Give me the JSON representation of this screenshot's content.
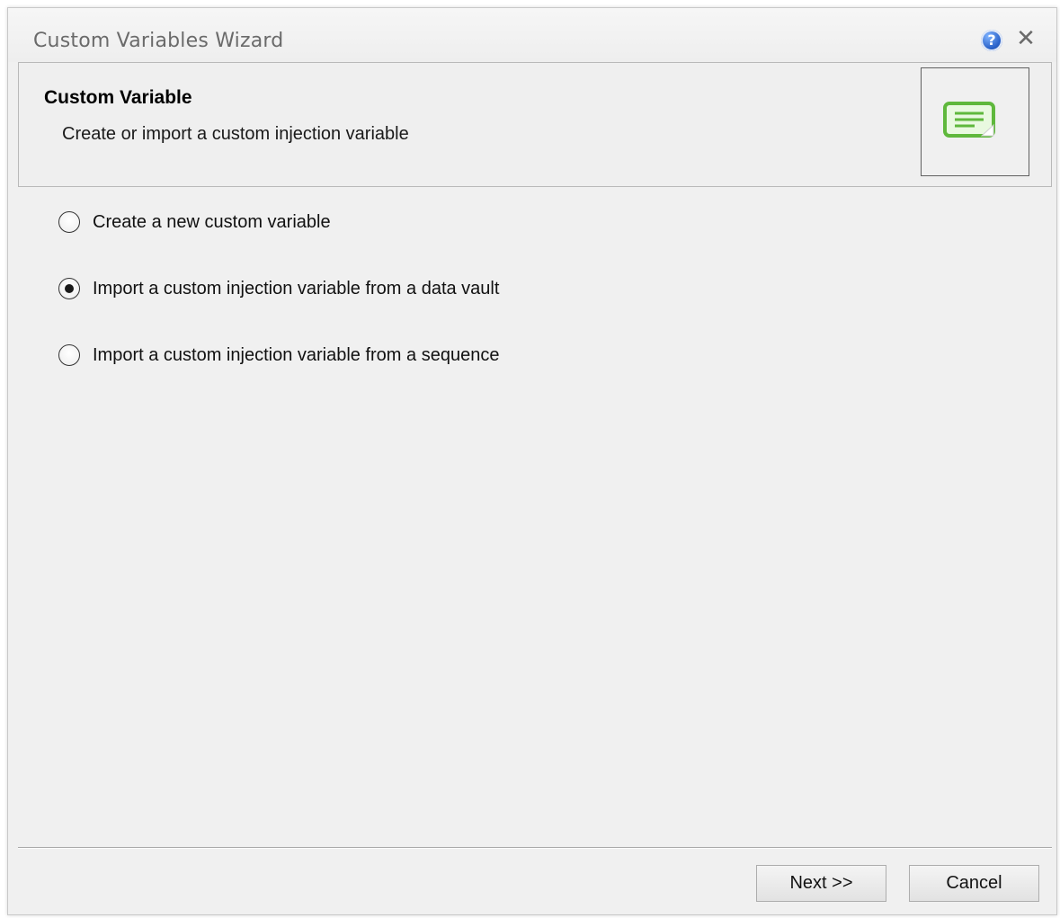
{
  "window": {
    "title": "Custom Variables Wizard",
    "help_glyph": "?",
    "close_glyph": "✕"
  },
  "header": {
    "title": "Custom Variable",
    "subtitle": "Create or import a custom injection variable",
    "icon": "note-icon",
    "icon_color": "#6cc24a"
  },
  "options": [
    {
      "label": "Create a new custom variable",
      "selected": false
    },
    {
      "label": "Import a custom injection variable from a data vault",
      "selected": true
    },
    {
      "label": "Import a custom injection variable from a sequence",
      "selected": false
    }
  ],
  "buttons": {
    "next": "Next >>",
    "cancel": "Cancel"
  }
}
